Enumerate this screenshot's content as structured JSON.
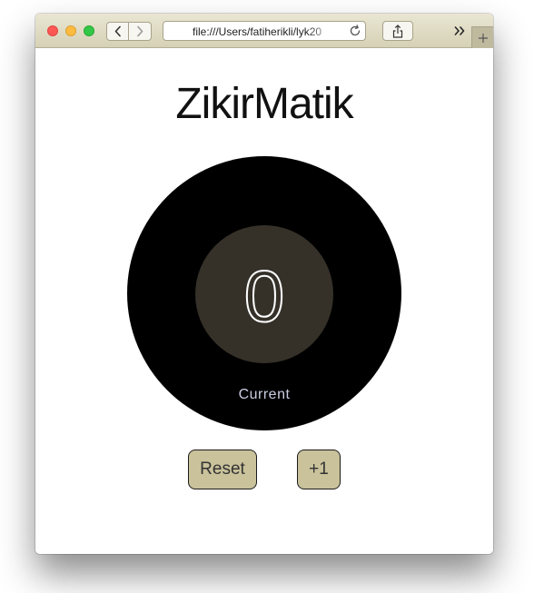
{
  "browser": {
    "url": "file:///Users/fatiherikli/lyk20",
    "icons": {
      "back": "chevron-left-icon",
      "forward": "chevron-right-icon",
      "reload": "reload-icon",
      "share": "share-icon",
      "more": "double-chevron-right-icon",
      "new_tab": "plus-icon"
    }
  },
  "app": {
    "title": "ZikirMatik",
    "counter": {
      "value": "0",
      "label": "Current"
    },
    "buttons": {
      "reset": "Reset",
      "increment": "+1"
    }
  },
  "colors": {
    "toolbar": "#dcd8c0",
    "outer_circle": "#000000",
    "inner_circle": "#353129",
    "counter_text": "#ffffff",
    "label_text": "#c8cde0",
    "button_bg": "#c9c29b"
  }
}
